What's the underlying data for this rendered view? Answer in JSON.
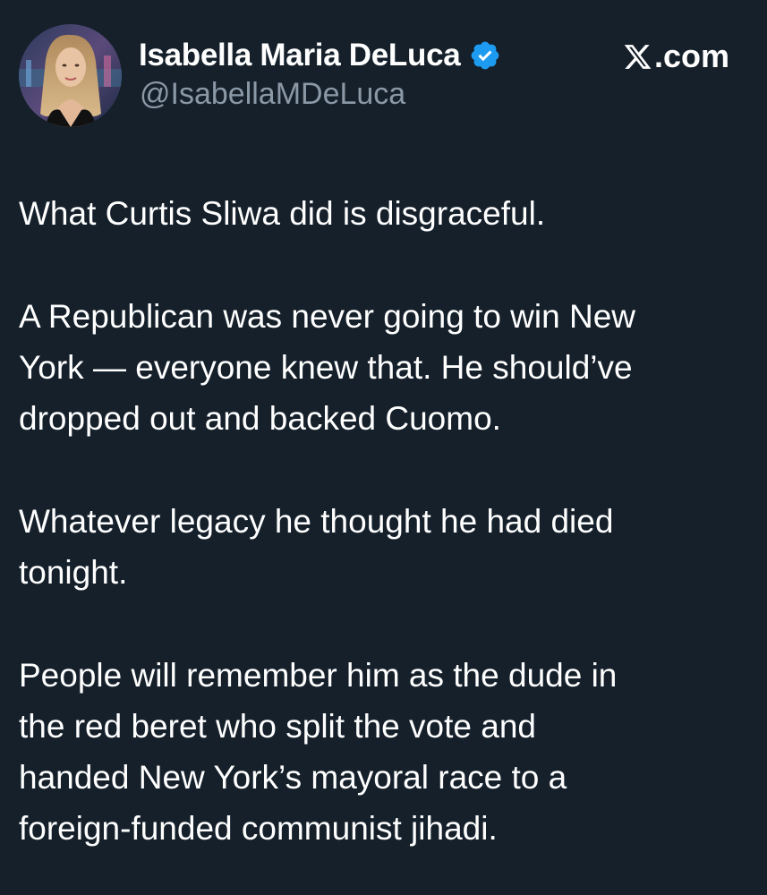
{
  "tweet": {
    "author": {
      "display_name": "Isabella Maria DeLuca",
      "handle": "@IsabellaMDeLuca",
      "verified": true,
      "verified_color": "#1d9bf0"
    },
    "source_label": ".com",
    "source_logo": "x-logo-icon",
    "paragraphs": [
      "What Curtis Sliwa did is disgraceful.",
      "A Republican was never going to win New\nYork — everyone knew that. He should’ve\ndropped out and backed Cuomo.",
      "Whatever legacy he thought he had died\ntonight.",
      "People will remember him as the dude in\nthe red beret who split the vote and\nhanded New York’s mayoral race to a\nforeign-funded communist jihadi."
    ]
  },
  "colors": {
    "background": "#15202b",
    "text": "#ffffff",
    "secondary_text": "#8b98a5",
    "accent": "#1d9bf0"
  }
}
